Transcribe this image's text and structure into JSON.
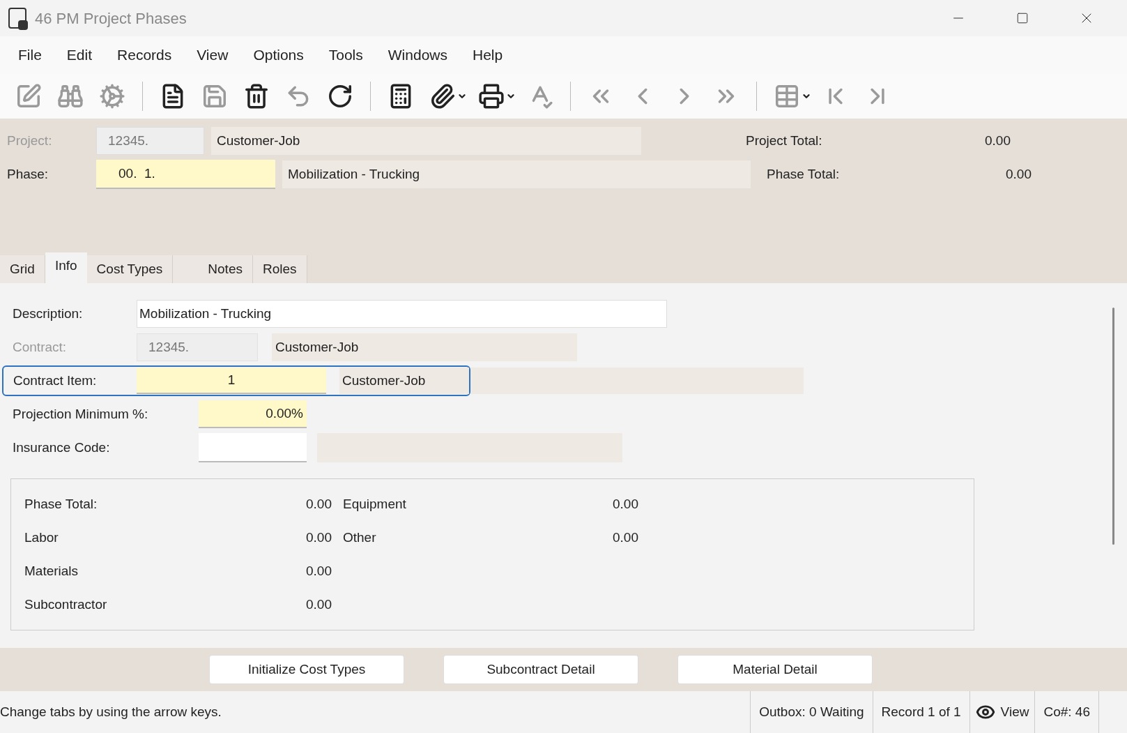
{
  "window": {
    "title": "46 PM Project Phases"
  },
  "menu": [
    "File",
    "Edit",
    "Records",
    "View",
    "Options",
    "Tools",
    "Windows",
    "Help"
  ],
  "toolbar": [
    {
      "kind": "edit",
      "disabled": true
    },
    {
      "kind": "find",
      "disabled": true
    },
    {
      "kind": "settings",
      "disabled": true
    },
    {
      "kind": "sep"
    },
    {
      "kind": "new",
      "disabled": false
    },
    {
      "kind": "save",
      "disabled": true
    },
    {
      "kind": "delete",
      "disabled": false
    },
    {
      "kind": "undo",
      "disabled": true
    },
    {
      "kind": "refresh",
      "disabled": false
    },
    {
      "kind": "sep"
    },
    {
      "kind": "calculator",
      "disabled": false
    },
    {
      "kind": "attach",
      "disabled": false,
      "dropdown": true
    },
    {
      "kind": "print",
      "disabled": false,
      "dropdown": true
    },
    {
      "kind": "spell",
      "disabled": true
    },
    {
      "kind": "sep"
    },
    {
      "kind": "first",
      "disabled": true
    },
    {
      "kind": "prev",
      "disabled": true
    },
    {
      "kind": "next",
      "disabled": true
    },
    {
      "kind": "last",
      "disabled": true
    },
    {
      "kind": "sep"
    },
    {
      "kind": "grid",
      "disabled": true,
      "dropdown": true
    },
    {
      "kind": "start",
      "disabled": true
    },
    {
      "kind": "end",
      "disabled": true
    }
  ],
  "header": {
    "project": {
      "label": "Project:",
      "disabled": true,
      "code": "12345.",
      "description": "Customer-Job"
    },
    "phase": {
      "label": "Phase:",
      "disabled": false,
      "code": "00.  1.",
      "description": "Mobilization - Trucking"
    },
    "project_total": {
      "label": "Project Total:",
      "value": "0.00"
    },
    "phase_total": {
      "label": "Phase Total:",
      "value": "0.00"
    }
  },
  "tabs": [
    {
      "label": "Grid",
      "selected": false
    },
    {
      "label": "Info",
      "selected": true
    },
    {
      "label": "Cost Types",
      "selected": false
    },
    {
      "label": "Notes",
      "selected": false
    },
    {
      "label": "Roles",
      "selected": false
    }
  ],
  "form": {
    "description": {
      "label": "Description:",
      "value": "Mobilization - Trucking"
    },
    "contract": {
      "label": "Contract:",
      "disabled": true,
      "code": "12345.",
      "description": "Customer-Job"
    },
    "contract_item": {
      "label": "Contract Item:",
      "focused": true,
      "code": "1",
      "description": "Customer-Job"
    },
    "projection_minimum": {
      "label": "Projection Minimum %:",
      "value": "0.00%"
    },
    "insurance_code": {
      "label": "Insurance Code:"
    }
  },
  "totals": [
    [
      {
        "label": "Phase Total:",
        "value": "0.00"
      },
      {
        "label": "Labor",
        "value": "0.00"
      },
      {
        "label": "Materials",
        "value": "0.00"
      },
      {
        "label": "Subcontractor",
        "value": "0.00"
      }
    ],
    [
      {
        "label": "Equipment",
        "value": "0.00"
      },
      {
        "label": "Other",
        "value": "0.00"
      }
    ]
  ],
  "buttons": [
    "Initialize Cost Types",
    "Subcontract Detail",
    "Material Detail"
  ],
  "status_bar": {
    "message": "Change tabs by using the arrow keys.",
    "outbox": "Outbox: 0 Waiting",
    "record": "Record 1 of 1",
    "mode": "View",
    "company": "Co#: 46"
  }
}
